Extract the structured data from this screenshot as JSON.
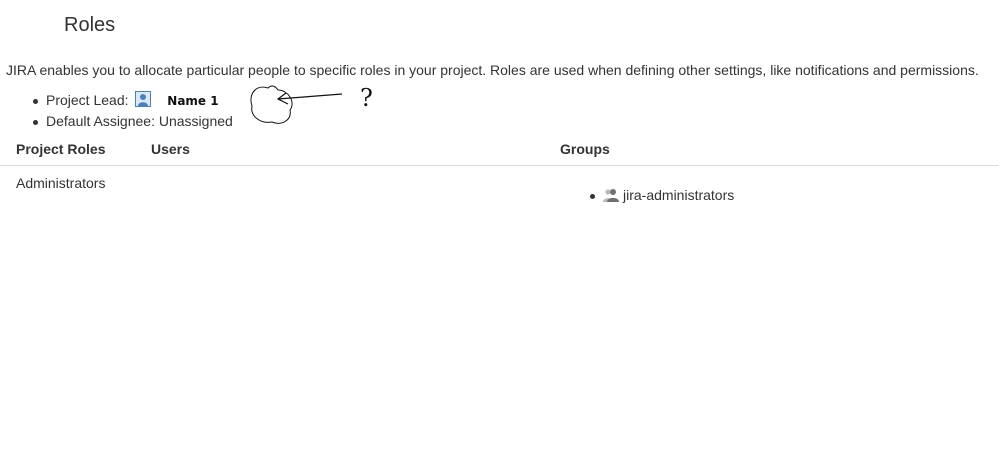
{
  "page": {
    "title": "Roles",
    "intro": "JIRA enables you to allocate particular people to specific roles in your project. Roles are used when defining other settings, like notifications and permissions."
  },
  "project_lead": {
    "label": "Project Lead:",
    "avatar_icon": "user-avatar-icon",
    "name": "Name 1"
  },
  "default_assignee": {
    "label": "Default Assignee:",
    "value": "Unassigned"
  },
  "annotation": {
    "text": "?"
  },
  "table": {
    "headers": {
      "roles": "Project Roles",
      "users": "Users",
      "groups": "Groups"
    },
    "rows": [
      {
        "role": "Administrators",
        "users": [],
        "groups": [
          {
            "icon": "group-icon",
            "name": "jira-administrators"
          }
        ]
      }
    ]
  },
  "colors": {
    "text": "#333333",
    "avatar_blue": "#4a7fc1",
    "divider": "#dcdcdc"
  }
}
